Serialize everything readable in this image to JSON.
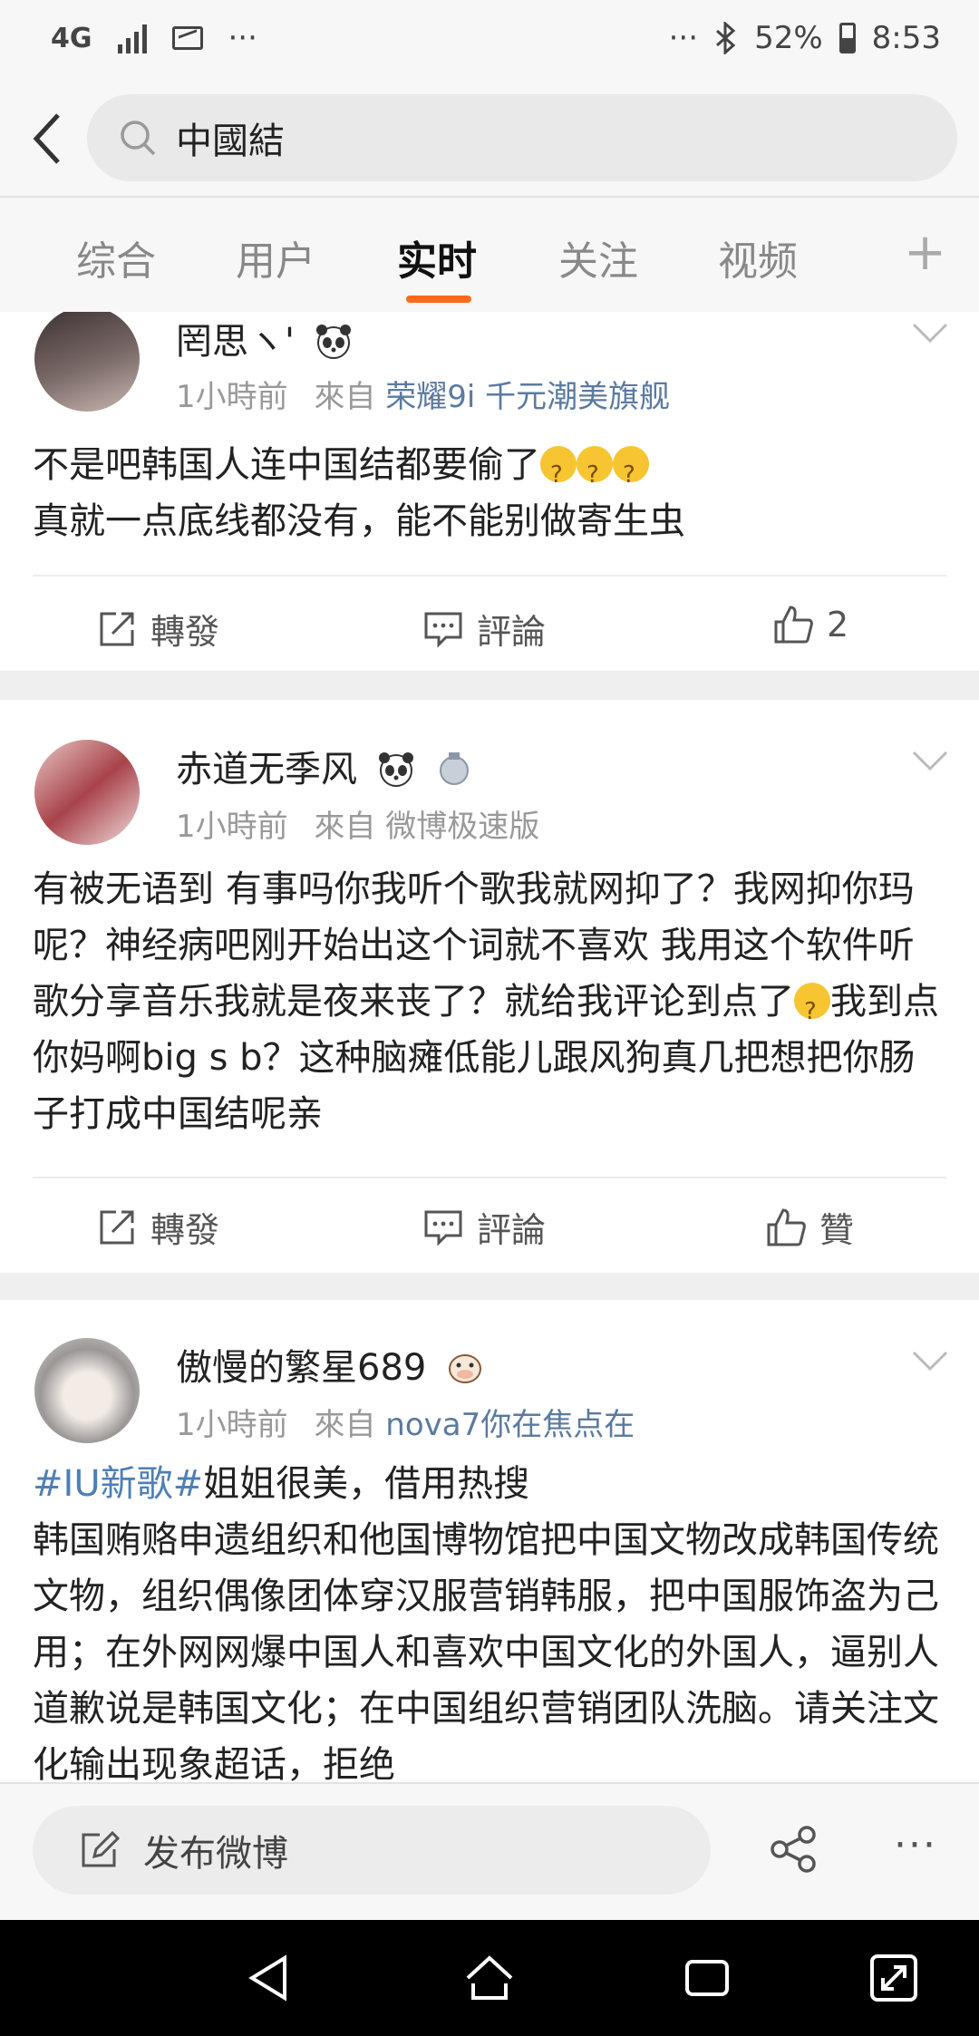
{
  "status_bar": {
    "network": "4G",
    "more_left": "···",
    "more_right": "···",
    "battery": "52%",
    "time": "8:53"
  },
  "search": {
    "query": "中國結"
  },
  "tabs": [
    {
      "label": "综合"
    },
    {
      "label": "用户"
    },
    {
      "label": "实时"
    },
    {
      "label": "关注"
    },
    {
      "label": "视频"
    }
  ],
  "tab_add": "+",
  "posts": [
    {
      "username": "罔思ヽ'",
      "time": "1小時前",
      "from_prefix": "來自",
      "source": "荣耀9i 千元潮美旗舰",
      "text_line1": "不是吧韩国人连中国结都要偷了",
      "text_line2": "真就一点底线都没有，能不能别做寄生虫",
      "repost": "轉發",
      "comment": "評論",
      "like": "2"
    },
    {
      "username": "赤道无季风",
      "time": "1小時前",
      "from_prefix": "來自",
      "source": "微博极速版",
      "text_part1": "有被无语到 有事吗你我听个歌我就网抑了？我网抑你玛呢？神经病吧刚开始出这个词就不喜欢 我用这个软件听歌分享音乐我就是夜来丧了？就给我评论到点了",
      "text_part2": "我到点你妈啊big s b？这种脑瘫低能儿跟风狗真几把想把你肠子打成中国结呢亲",
      "repost": "轉發",
      "comment": "評論",
      "like": "贊"
    },
    {
      "username": "傲慢的繁星689",
      "time": "1小時前",
      "from_prefix": "來自",
      "source": "nova7你在焦点在",
      "hashtag": "#IU新歌#",
      "text_line1": "姐姐很美，借用热搜",
      "text_body": "韩国贿赂申遗组织和他国博物馆把中国文物改成韩国传统文物，组织偶像团体穿汉服营销韩服，把中国服饰盗为己用；在外网网爆中国人和喜欢中国文化的外国人，逼别人道歉说是韩国文化；在中国组织营销团队洗脑。请关注文化输出现象超话，拒绝"
    }
  ],
  "bottom": {
    "compose_label": "发布微博",
    "more": "···"
  },
  "colors": {
    "accent": "#ff6a1a",
    "link": "#5b7aa0"
  }
}
